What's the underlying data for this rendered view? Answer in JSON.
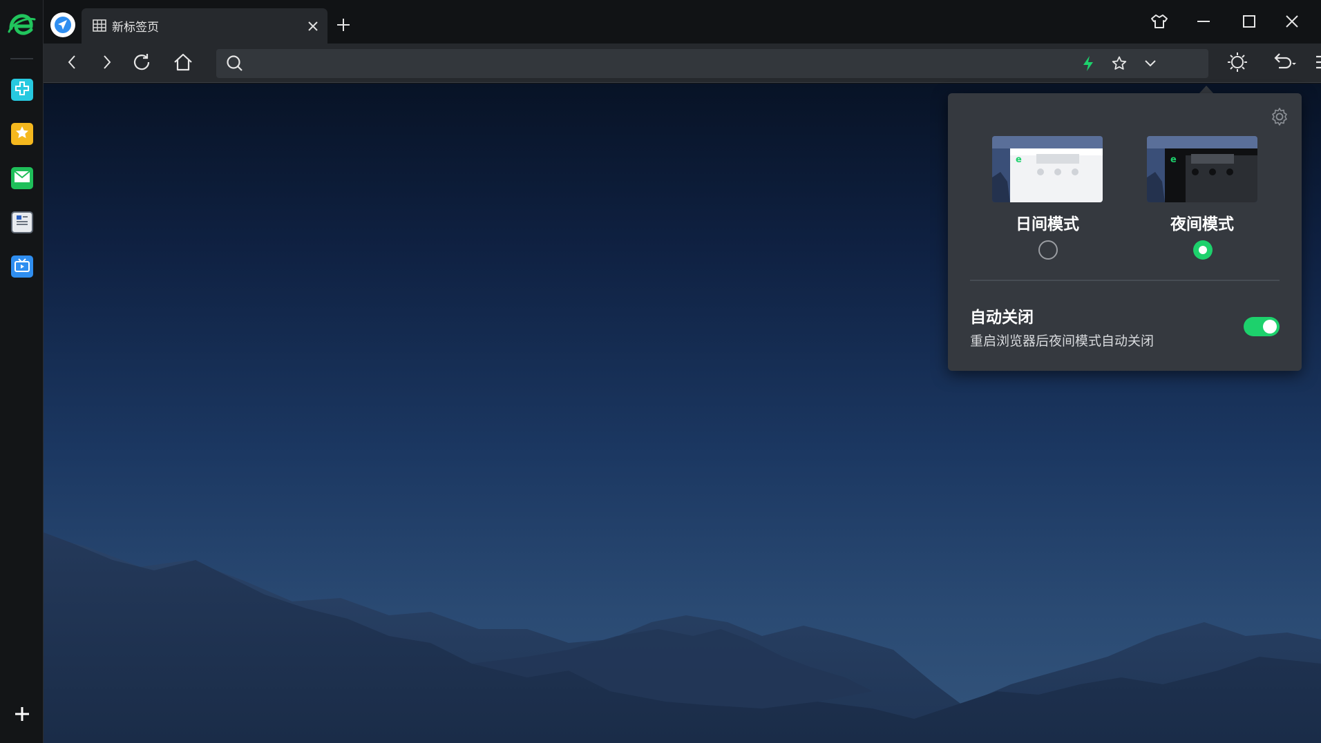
{
  "window": {
    "tab_title": "新标签页",
    "controls": [
      "skin-icon",
      "minimize-icon",
      "maximize-icon",
      "close-icon"
    ]
  },
  "sidebar": {
    "apps": [
      {
        "icon": "medical-plus-icon",
        "color": "#27c9e0"
      },
      {
        "icon": "star-favorites-icon",
        "color": "#f5b81e"
      },
      {
        "icon": "mail-icon",
        "color": "#1fbf5a"
      },
      {
        "icon": "document-icon",
        "color": "#e8ebef"
      },
      {
        "icon": "video-tv-icon",
        "color": "#2f8ef0"
      }
    ],
    "add_icon": "plus-icon"
  },
  "toolbar": {
    "address_value": "",
    "address_placeholder": "",
    "buttons": [
      "back-icon",
      "forward-icon",
      "refresh-icon",
      "home-icon",
      "lightning-icon",
      "star-icon",
      "chevron-down-icon",
      "theme-sun-icon",
      "undo-icon",
      "menu-icon"
    ]
  },
  "night_mode_popup": {
    "modes": [
      {
        "label": "日间模式",
        "selected": false
      },
      {
        "label": "夜间模式",
        "selected": true
      }
    ],
    "auto_close": {
      "title": "自动关闭",
      "description": "重启浏览器后夜间模式自动关闭",
      "enabled": true
    }
  },
  "colors": {
    "accent": "#1dd16c",
    "popup_bg": "#35393f",
    "toolbar_bg": "#26292d",
    "titlebar_bg": "#111315"
  }
}
